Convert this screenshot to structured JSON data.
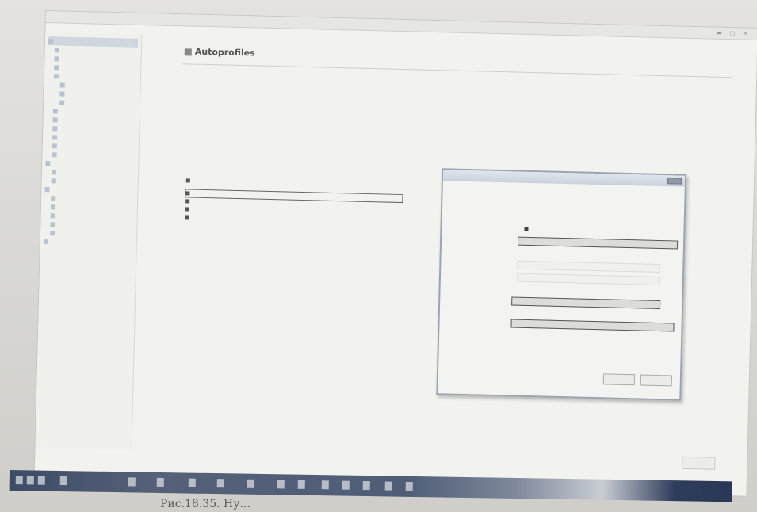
{
  "window": {
    "title": "",
    "controls_icon": "window-controls-icon"
  },
  "main": {
    "page_title": "Autoprofiles"
  },
  "caption": {
    "text": "Рис.18.35. Ну..."
  },
  "icons": {
    "page_icon": "folder-icon",
    "tree_icon": "tree-node-icon",
    "row_icon": "rule-icon",
    "dialog_close": "close-icon"
  },
  "colors": {
    "screen_bg": "#f2f2ef",
    "taskbar": "#3c4c66",
    "dialog_border": "#9aa5b1"
  }
}
